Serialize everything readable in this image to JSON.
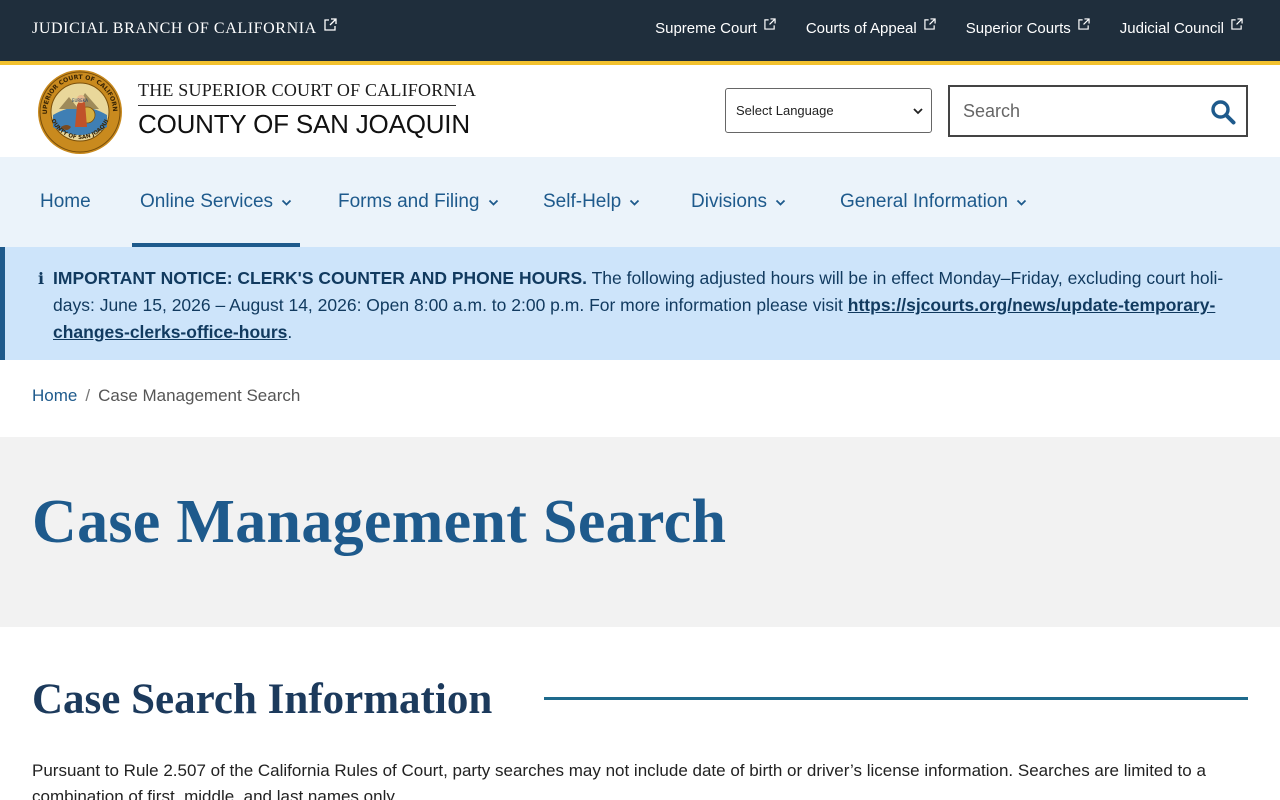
{
  "topbar": {
    "branch_label": "JUDICIAL BRANCH OF CALIFORNIA",
    "links": [
      {
        "label": "Supreme Court"
      },
      {
        "label": "Courts of Appeal"
      },
      {
        "label": "Superior Courts"
      },
      {
        "label": "Judicial Council"
      }
    ]
  },
  "header": {
    "court_line1": "THE SUPERIOR COURT OF CALIFORNIA",
    "court_line2": "COUNTY OF SAN JOAQUIN",
    "seal_text_outer": "SUPERIOR COURT OF CALIFORNIA",
    "seal_text_bottom": "COUNTY OF SAN JOAQUIN",
    "seal_motto": "EUREKA",
    "language_select": {
      "selected": "Select Language"
    },
    "search": {
      "placeholder": "Search"
    }
  },
  "nav": {
    "items": [
      {
        "label": "Home",
        "has_dropdown": false,
        "active": false
      },
      {
        "label": "Online Services",
        "has_dropdown": true,
        "active": true
      },
      {
        "label": "Forms and Filing",
        "has_dropdown": true,
        "active": false
      },
      {
        "label": "Self-Help",
        "has_dropdown": true,
        "active": false
      },
      {
        "label": "Divisions",
        "has_dropdown": true,
        "active": false
      },
      {
        "label": "General Information",
        "has_dropdown": true,
        "active": false
      }
    ]
  },
  "notice": {
    "icon": "info-icon",
    "bold_text": "IMPORTANT NOTICE: CLERK'S COUNTER AND PHONE HOURS.",
    "body_text": " The following adjusted hours will be in effect Monday–Friday, excluding court holi­days: June 15, 2026 – August 14, 2026: Open 8:00 a.m. to 2:00 p.m. For more information please visit ",
    "link_text": "https://sjcourts.org/news/update-temporary-changes-clerks-office-hours",
    "end_text": "."
  },
  "breadcrumb": {
    "home": "Home",
    "separator": "/",
    "current": "Case Management Search"
  },
  "page": {
    "title": "Case Management Search",
    "section_heading": "Case Search Information",
    "paragraph": "Pursuant to Rule 2.507 of the California Rules of Court, party searches may not include date of birth or driver’s license information. Searches are limited to a combina­tion of first, middle, and last names only."
  },
  "colors": {
    "topbar_bg": "#1f2e3c",
    "gold_accent": "#f2c12e",
    "nav_bg": "#ebf3fa",
    "brand_blue": "#1e5a8c",
    "notice_bg": "#cde4fa",
    "title_band_bg": "#f2f2f2"
  }
}
